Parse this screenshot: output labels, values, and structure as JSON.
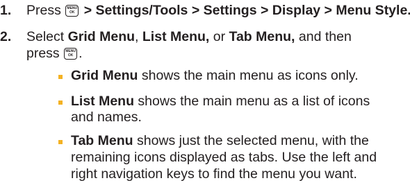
{
  "steps": [
    {
      "number": "1.",
      "pre": "Press",
      "path": "> Settings/Tools > Settings > Display > Menu Style."
    },
    {
      "number": "2.",
      "pre": "Select",
      "opt1": "Grid Menu",
      "sep1": ",",
      "opt2": "List Menu,",
      "word_or": "or",
      "opt3": "Tab Menu,",
      "tail": "and then",
      "line2": "press",
      "line2_end": "."
    }
  ],
  "key_icon": {
    "name": "menu-ok-key-icon",
    "top": "MENU",
    "bottom": "OK"
  },
  "bullets": [
    {
      "term": "Grid Menu",
      "lines": [
        "shows the main menu as icons only."
      ]
    },
    {
      "term": "List Menu",
      "lines": [
        "shows the main menu as a list of icons",
        "and names."
      ]
    },
    {
      "term": "Tab Menu",
      "lines": [
        "shows just the selected menu, with the",
        "remaining icons displayed as tabs. Use the left and",
        "right navigation keys to find the menu you want."
      ]
    }
  ],
  "colors": {
    "text": "#231f20",
    "bullet": "#f4b223"
  }
}
